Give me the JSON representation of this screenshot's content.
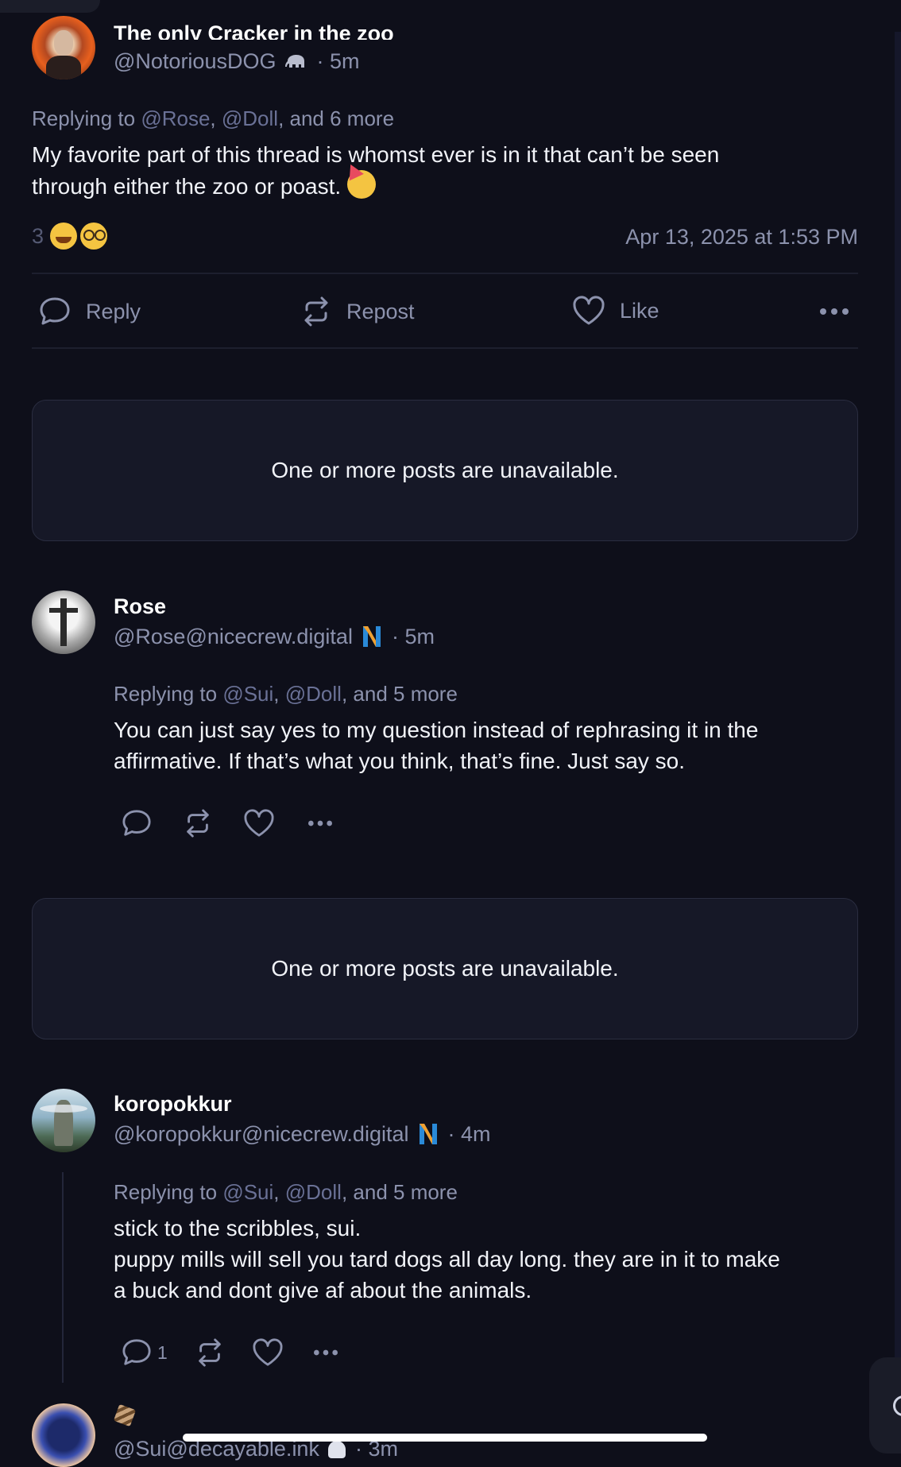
{
  "post1": {
    "display_name": "The only Cracker in the zoo",
    "handle": "@NotoriousDOG",
    "handle_suffix": "· 5m",
    "replying_prefix": "Replying to",
    "reply_users": [
      "@Rose",
      "@Doll"
    ],
    "reply_more": ", and 6 more",
    "text_line1": "My favorite part of this thread is whomst ever is in it that can’t be seen",
    "text_line2": "through either the zoo or poast.",
    "reaction_count": "3",
    "timestamp": "Apr 13, 2025 at 1:53 PM",
    "actions": {
      "reply": "Reply",
      "repost": "Repost",
      "like": "Like"
    }
  },
  "unavailable_text": "One or more posts are unavailable.",
  "post2": {
    "display_name": "Rose",
    "handle": "@Rose@nicecrew.digital",
    "handle_suffix": "· 5m",
    "replying_prefix": "Replying to",
    "reply_users": [
      "@Sui",
      "@Doll"
    ],
    "reply_more": ", and 5 more",
    "text_line1": "You can just say yes to my question instead of rephrasing it in the",
    "text_line2": "affirmative. If that’s what you think, that’s fine. Just say so."
  },
  "post3": {
    "display_name": "koropokkur",
    "handle": "@koropokkur@nicecrew.digital",
    "handle_suffix": "· 4m",
    "replying_prefix": "Replying to",
    "reply_users": [
      "@Sui",
      "@Doll"
    ],
    "reply_more": ", and 5 more",
    "text_line1": "stick to the scribbles, sui.",
    "text_line2": "puppy mills will sell you tard dogs all day long. they are in it to make",
    "text_line3": "a buck and dont give af about the animals.",
    "reply_count": "1"
  },
  "post4": {
    "handle": "@Sui@decayable.ink",
    "handle_suffix": "· 3m"
  },
  "colors": {
    "background": "#0e0f1a",
    "card": "#161827",
    "muted": "#8c92ad",
    "link": "#6a7196"
  }
}
